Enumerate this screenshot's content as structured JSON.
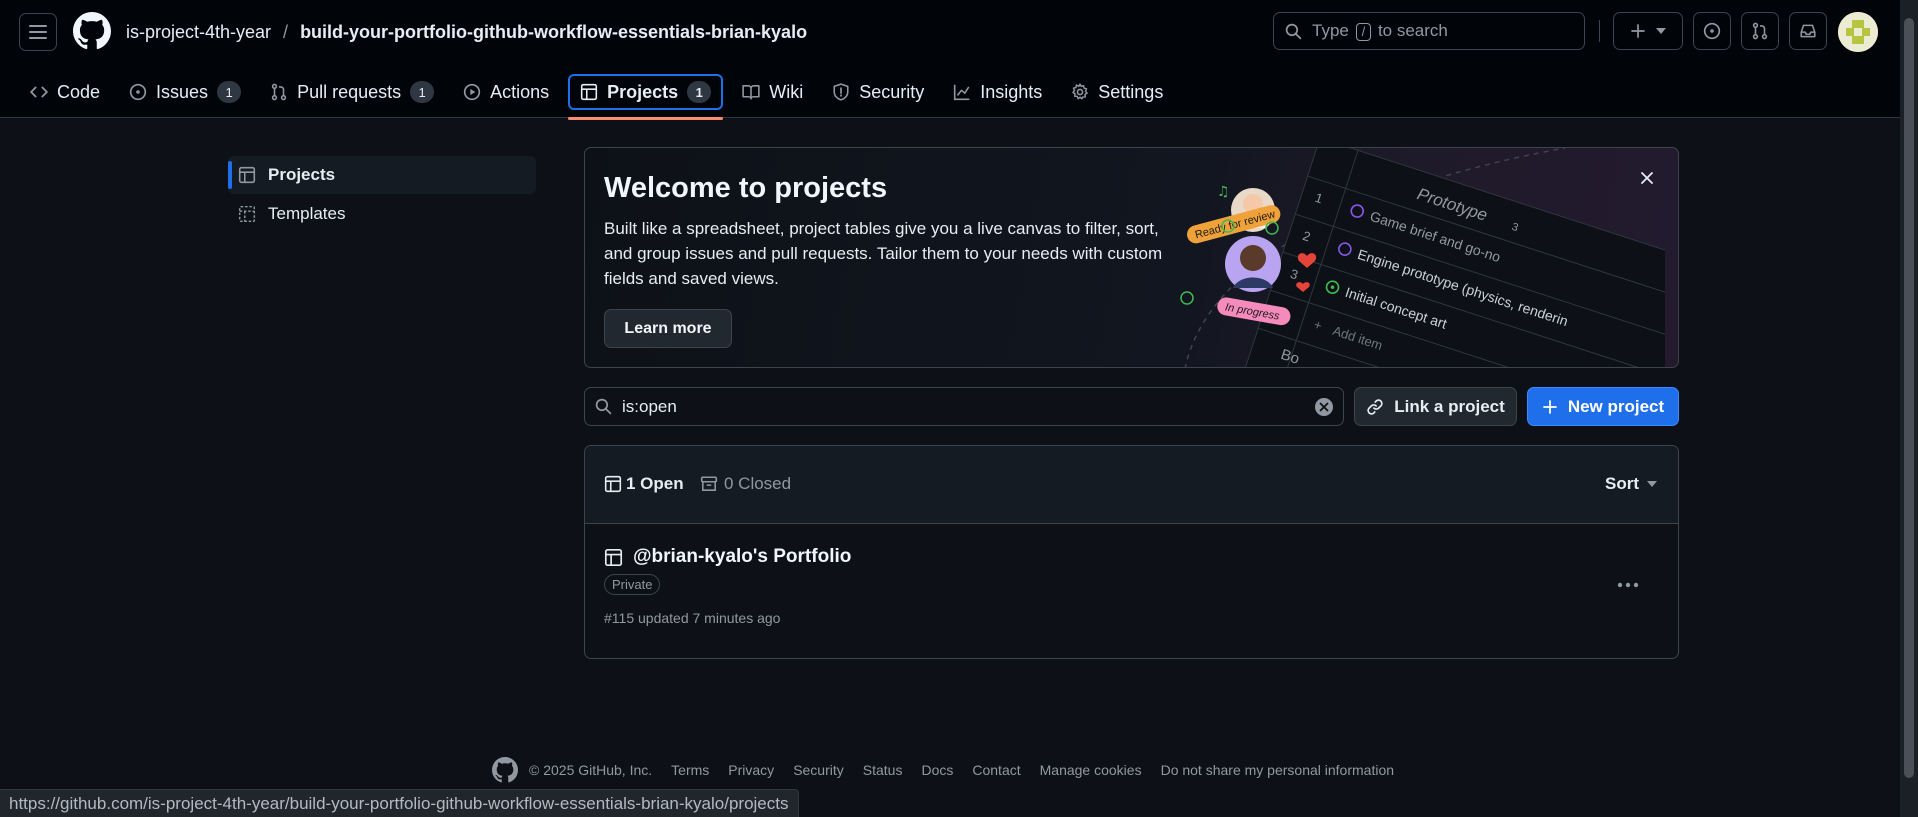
{
  "header": {
    "owner": "is-project-4th-year",
    "separator": "/",
    "repo": "build-your-portfolio-github-workflow-essentials-brian-kyalo",
    "search": {
      "prefix": "Type",
      "key": "/",
      "suffix": "to search"
    }
  },
  "tabs": [
    {
      "label": "Code",
      "icon": "code-icon"
    },
    {
      "label": "Issues",
      "count": "1",
      "icon": "issue-opened-icon"
    },
    {
      "label": "Pull requests",
      "count": "1",
      "icon": "git-pull-request-icon"
    },
    {
      "label": "Actions",
      "icon": "play-icon"
    },
    {
      "label": "Projects",
      "count": "1",
      "icon": "table-icon",
      "selected": true
    },
    {
      "label": "Wiki",
      "icon": "book-icon"
    },
    {
      "label": "Security",
      "icon": "shield-icon"
    },
    {
      "label": "Insights",
      "icon": "graph-icon"
    },
    {
      "label": "Settings",
      "icon": "gear-icon"
    }
  ],
  "sidebar": {
    "items": [
      {
        "label": "Projects",
        "icon": "table-icon",
        "active": true
      },
      {
        "label": "Templates",
        "icon": "template-icon"
      }
    ]
  },
  "banner": {
    "title": "Welcome to projects",
    "text": "Built like a spreadsheet, project tables give you a live canvas to filter, sort, and group issues and pull requests. Tailor them to your needs with custom fields and saved views.",
    "button": "Learn more",
    "art": {
      "tag_ready": "Ready for review",
      "tag_progress": "In progress",
      "group": "Prototype",
      "group_count": "3",
      "rows": [
        {
          "num": "1",
          "text": "Game brief and go-no"
        },
        {
          "num": "2",
          "text": "Engine prototype (physics, renderin"
        },
        {
          "num": "3",
          "text": "Initial concept art"
        }
      ],
      "add_item": "Add item",
      "next_group": "Bo"
    }
  },
  "filter": {
    "value": "is:open"
  },
  "actions": {
    "link": "Link a project",
    "new": "New project"
  },
  "list": {
    "open_label": "1 Open",
    "closed_label": "0 Closed",
    "sort_label": "Sort",
    "projects": [
      {
        "title": "@brian-kyalo's Portfolio",
        "badge": "Private",
        "meta": "#115 updated 7 minutes ago"
      }
    ]
  },
  "footer": {
    "copyright": "© 2025 GitHub, Inc.",
    "links": [
      "Terms",
      "Privacy",
      "Security",
      "Status",
      "Docs",
      "Contact",
      "Manage cookies",
      "Do not share my personal information"
    ]
  },
  "status_url": "https://github.com/is-project-4th-year/build-your-portfolio-github-workflow-essentials-brian-kyalo/projects",
  "colors": {
    "accent": "#1f6feb",
    "tab_underline": "#fd8c73",
    "background": "#0d1117"
  }
}
